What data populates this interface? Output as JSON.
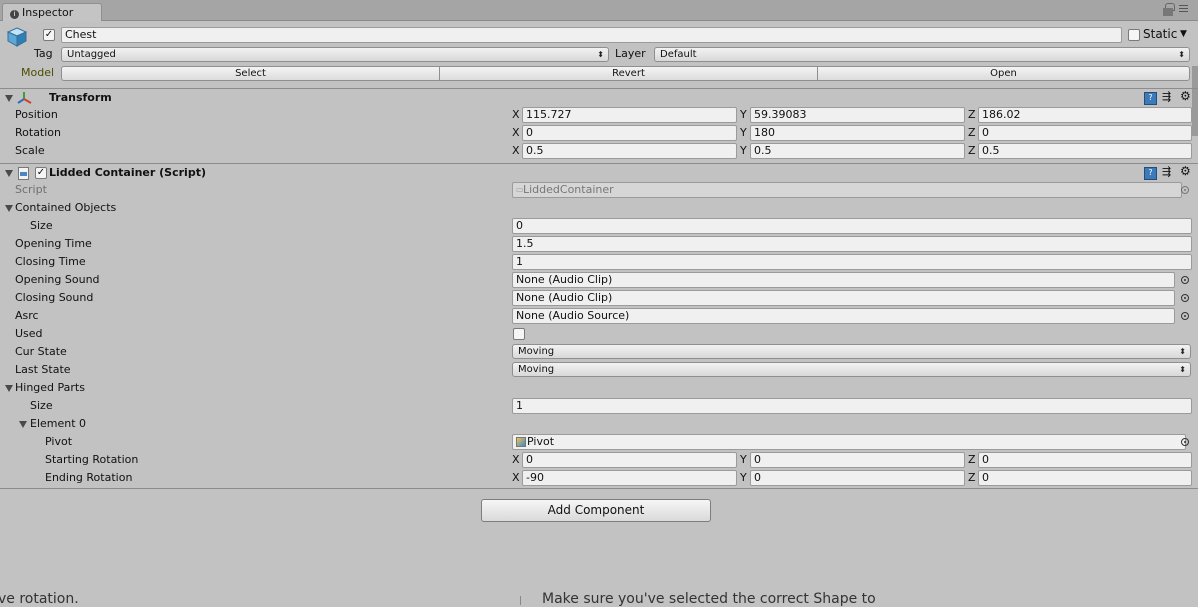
{
  "tab": {
    "title": "Inspector"
  },
  "object": {
    "name": "Chest",
    "static_label": "Static",
    "tag_label": "Tag",
    "tag_value": "Untagged",
    "layer_label": "Layer",
    "layer_value": "Default",
    "model_label": "Model",
    "model_buttons": [
      "Select",
      "Revert",
      "Open"
    ]
  },
  "transform": {
    "title": "Transform",
    "rows": [
      {
        "label": "Position",
        "x": "115.727",
        "y": "59.39083",
        "z": "186.02"
      },
      {
        "label": "Rotation",
        "x": "0",
        "y": "180",
        "z": "0"
      },
      {
        "label": "Scale",
        "x": "0.5",
        "y": "0.5",
        "z": "0.5"
      }
    ]
  },
  "axes": {
    "x": "X",
    "y": "Y",
    "z": "Z"
  },
  "script": {
    "title": "Lidded Container (Script)",
    "script_label": "Script",
    "script_value": "LiddedContainer",
    "contained_objects_label": "Contained Objects",
    "size_label": "Size",
    "contained_size": "0",
    "opening_time_label": "Opening Time",
    "opening_time": "1.5",
    "closing_time_label": "Closing Time",
    "closing_time": "1",
    "opening_sound_label": "Opening Sound",
    "opening_sound": "None (Audio Clip)",
    "closing_sound_label": "Closing Sound",
    "closing_sound": "None (Audio Clip)",
    "asrc_label": "Asrc",
    "asrc": "None (Audio Source)",
    "used_label": "Used",
    "cur_state_label": "Cur State",
    "cur_state": "Moving",
    "last_state_label": "Last State",
    "last_state": "Moving",
    "hinged_parts_label": "Hinged Parts",
    "hinged_size": "1",
    "element_label": "Element 0",
    "pivot_label": "Pivot",
    "pivot_value": "Pivot",
    "starting_rotation_label": "Starting Rotation",
    "starting_rotation": {
      "x": "0",
      "y": "0",
      "z": "0"
    },
    "ending_rotation_label": "Ending Rotation",
    "ending_rotation": {
      "x": "-90",
      "y": "0",
      "z": "0"
    }
  },
  "add_component": "Add Component",
  "behind_text": {
    "left": "ve rotation.",
    "right": "Make sure you've selected the correct Shape to"
  }
}
